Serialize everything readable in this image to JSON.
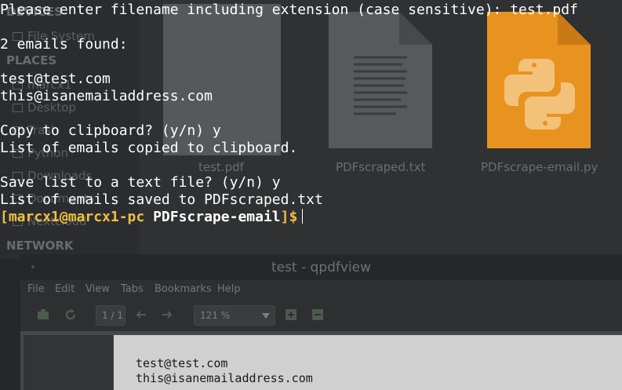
{
  "file_manager": {
    "sidebar": {
      "devices_header": "DEVICES",
      "devices": [
        {
          "label": "File System",
          "icon": "hard-drive-icon"
        }
      ],
      "places_header": "PLACES",
      "places": [
        {
          "label": "marcx1",
          "icon": "home-icon"
        },
        {
          "label": "Desktop",
          "icon": "folder-icon"
        },
        {
          "label": "Trash",
          "icon": "trash-icon"
        },
        {
          "label": "Python",
          "icon": "folder-icon"
        },
        {
          "label": "Downloads",
          "icon": "download-icon"
        },
        {
          "label": "Documents",
          "icon": "folder-icon"
        },
        {
          "label": "Nextcloud",
          "icon": "folder-icon"
        }
      ],
      "network_header": "NETWORK"
    },
    "files": [
      {
        "name": "test.pdf",
        "icon": "pdf-file-icon"
      },
      {
        "name": "PDFscraped.txt",
        "icon": "text-file-icon"
      },
      {
        "name": "PDFscrape-email.py",
        "icon": "python-file-icon"
      }
    ],
    "colors": {
      "python_file": "#e89320",
      "python_logo": "#f3c27a"
    }
  },
  "terminal": {
    "lines": [
      "Please enter filename including extension (case sensitive): test.pdf",
      "",
      "2 emails found:",
      "",
      "test@test.com",
      "this@isanemailaddress.com",
      "",
      "Copy to clipboard? (y/n) y",
      "List of emails copied to clipboard.",
      "",
      "Save list to a text file? (y/n) y",
      "List of emails saved to PDFscraped.txt"
    ],
    "prompt": {
      "open": "[",
      "user_host": "marcx1@marcx1-pc",
      "dir": "PDFscrape-email",
      "close": "]$"
    },
    "colors": {
      "prompt": "#f0c040",
      "text": "#ffffff"
    }
  },
  "qpdfview": {
    "title": "test - qpdfview",
    "menu": [
      "File",
      "Edit",
      "View",
      "Tabs",
      "Bookmarks",
      "Help"
    ],
    "page_field": "1 / 1",
    "zoom": "121 %",
    "document_lines": [
      "test@test.com",
      "this@isanemailaddress.com"
    ]
  }
}
